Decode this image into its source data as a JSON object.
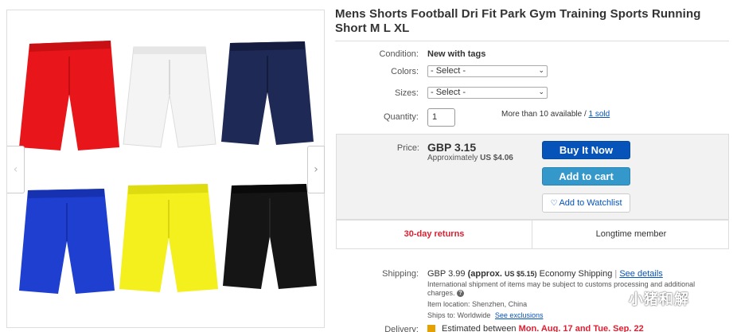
{
  "product": {
    "title": "Mens Shorts Football Dri Fit Park Gym Training Sports Running Short M L XL"
  },
  "gallery": {
    "prev_icon": "chevron-left-icon",
    "next_icon": "chevron-right-icon",
    "items": [
      {
        "name": "red-shorts-image",
        "color": "#e8161a"
      },
      {
        "name": "white-shorts-image",
        "color": "#f4f4f4"
      },
      {
        "name": "navy-shorts-image",
        "color": "#1e2a55"
      },
      {
        "name": "blue-shorts-image",
        "color": "#1f3fd0"
      },
      {
        "name": "yellow-shorts-image",
        "color": "#f3f01d"
      },
      {
        "name": "black-shorts-image",
        "color": "#151515"
      }
    ]
  },
  "details": {
    "condition_label": "Condition:",
    "condition_value": "New with tags",
    "colors_label": "Colors:",
    "colors_selected": "- Select -",
    "sizes_label": "Sizes:",
    "sizes_selected": "- Select -",
    "quantity_label": "Quantity:",
    "quantity_value": "1",
    "availability_text": "More than 10 available /",
    "sold_link": "1 sold"
  },
  "pricing": {
    "price_label": "Price:",
    "price": "GBP 3.15",
    "approx_prefix": "Approximately",
    "approx_value": "US $4.06",
    "buy_now": "Buy It Now",
    "add_to_cart": "Add to cart",
    "watchlist": "Add to Watchlist"
  },
  "returns_bar": {
    "returns": "30-day returns",
    "member": "Longtime member"
  },
  "shipping": {
    "label": "Shipping:",
    "cost": "GBP 3.99",
    "approx": "(approx.",
    "approx_value": "US $5.15)",
    "method": "Economy Shipping",
    "separator": "|",
    "details_link": "See details",
    "note": "International shipment of items may be subject to customs processing and additional charges.",
    "location_label": "Item location:",
    "location": "Shenzhen, China",
    "ships_to_label": "Ships to:",
    "ships_to": "Worldwide",
    "exclusions_link": "See exclusions"
  },
  "delivery": {
    "label": "Delivery:",
    "text": "Estimated between",
    "dates": "Mon. Aug. 17 and Tue. Sep. 22"
  },
  "watermark": {
    "text": "小猪和解"
  },
  "colors": {
    "link": "#0654ba",
    "buy_button": "#0654ba",
    "cart_button": "#3498ca",
    "returns_red": "#dd1e31",
    "price_box_bg": "#f2f2f2"
  }
}
